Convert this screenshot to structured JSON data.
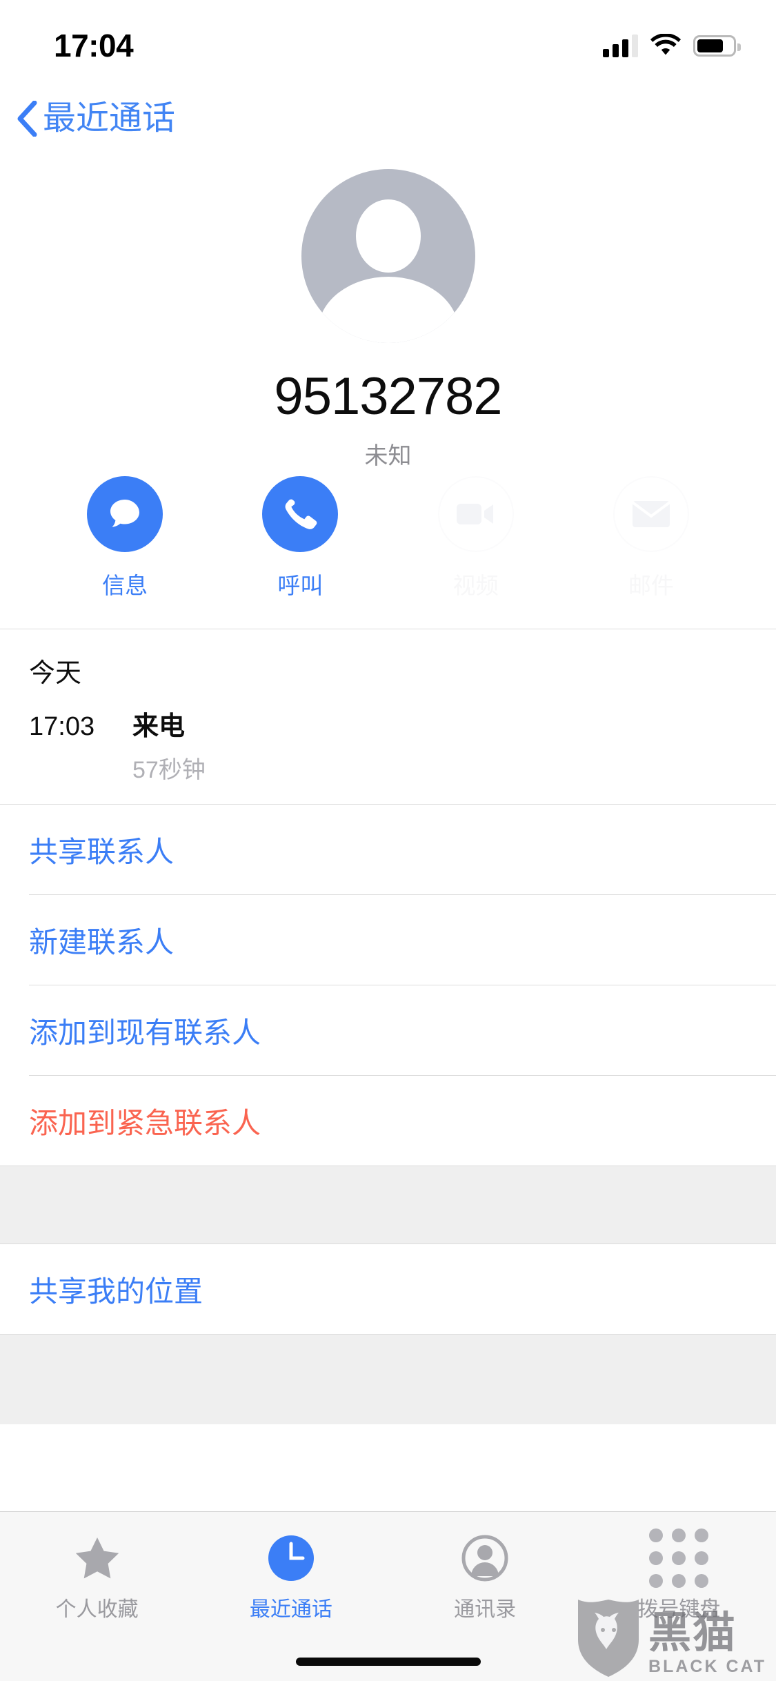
{
  "status_bar": {
    "time": "17:04",
    "signal_icon": "signal-bars-icon",
    "wifi_icon": "wifi-icon",
    "battery_icon": "battery-icon",
    "battery_level_pct": 74
  },
  "nav": {
    "back_label": "最近通话",
    "back_icon": "chevron-left-icon"
  },
  "contact": {
    "avatar_icon": "person-placeholder-avatar",
    "number": "95132782",
    "subtitle": "未知"
  },
  "actions": [
    {
      "label": "信息",
      "icon": "message-bubble-icon",
      "enabled": true
    },
    {
      "label": "呼叫",
      "icon": "phone-handset-icon",
      "enabled": true
    },
    {
      "label": "视频",
      "icon": "video-camera-icon",
      "enabled": false
    },
    {
      "label": "邮件",
      "icon": "envelope-icon",
      "enabled": false
    }
  ],
  "call_log": {
    "day": "今天",
    "time": "17:03",
    "type": "来电",
    "duration": "57秒钟"
  },
  "contact_actions": [
    {
      "label": "共享联系人",
      "style": "blue"
    },
    {
      "label": "新建联系人",
      "style": "blue"
    },
    {
      "label": "添加到现有联系人",
      "style": "blue"
    },
    {
      "label": "添加到紧急联系人",
      "style": "red"
    }
  ],
  "location_section": [
    {
      "label": "共享我的位置",
      "style": "blue"
    }
  ],
  "tabs": [
    {
      "label": "个人收藏",
      "icon": "star-icon",
      "active": false
    },
    {
      "label": "最近通话",
      "icon": "clock-icon",
      "active": true
    },
    {
      "label": "通讯录",
      "icon": "contacts-person-icon",
      "active": false
    },
    {
      "label": "拨号键盘",
      "icon": "keypad-dots-icon",
      "active": false
    }
  ],
  "watermark": {
    "shield_icon": "black-cat-shield-logo",
    "cn": "黑猫",
    "en": "BLACK CAT"
  },
  "colors": {
    "accent_blue": "#3b7ef6",
    "destructive_red": "#fa6450",
    "secondary_text": "#8d8d92",
    "group_background": "#efefef"
  }
}
